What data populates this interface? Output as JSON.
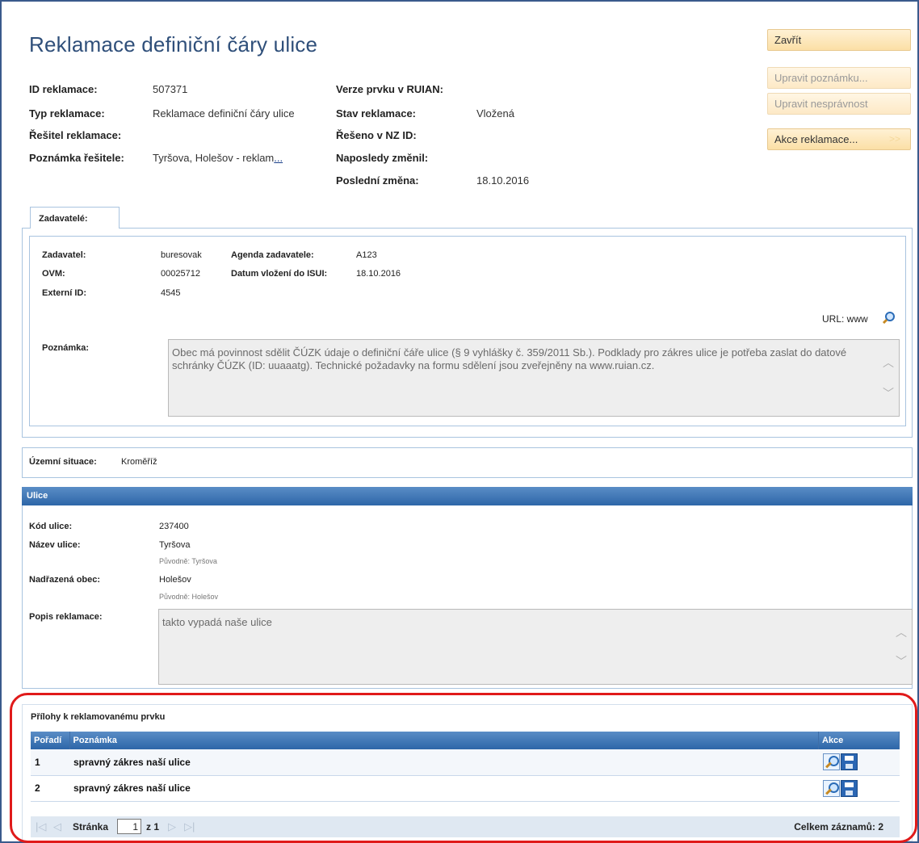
{
  "title": "Reklamace definiční čáry ulice",
  "header": {
    "id_label": "ID reklamace:",
    "id_value": "507371",
    "typ_label": "Typ reklamace:",
    "typ_value": "Reklamace definiční čáry ulice",
    "resitel_label": "Řešitel reklamace:",
    "resitel_value": "",
    "poznamka_label": "Poznámka řešitele:",
    "poznamka_value": "Tyršova, Holešov - reklam",
    "poznamka_more": "...",
    "verze_label": "Verze prvku v RUIAN:",
    "verze_value": "",
    "stav_label": "Stav reklamace:",
    "stav_value": "Vložená",
    "reseno_label": "Řešeno v NZ ID:",
    "reseno_value": "",
    "naposledy_label": "Naposledy změnil:",
    "naposledy_value": "",
    "posledni_label": "Poslední změna:",
    "posledni_value": "18.10.2016"
  },
  "buttons": {
    "zavrit": "Zavřít",
    "upravit_poznamku": "Upravit poznámku...",
    "upravit_nespravnost": "Upravit nesprávnost",
    "akce_reklamace": "Akce reklamace...",
    "akce_arrow": ">>"
  },
  "zadavatele": {
    "tab_label": "Zadavatelé:",
    "zadavatel_label": "Zadavatel:",
    "zadavatel_value": "buresovak",
    "agenda_label": "Agenda zadavatele:",
    "agenda_value": "A123",
    "ovm_label": "OVM:",
    "ovm_value": "00025712",
    "datum_label": "Datum vložení do ISUI:",
    "datum_value": "18.10.2016",
    "externi_label": "Externí ID:",
    "externi_value": "4545",
    "url_label": "URL: www",
    "poznamka_label": "Poznámka:",
    "poznamka_text": "Obec má povinnost sdělit ČÚZK údaje o definiční čáře ulice (§ 9 vyhlášky č. 359/2011 Sb.). Podklady pro zákres ulice je potřeba zaslat do datové schránky ČÚZK (ID: uuaaatg). Technické požadavky na formu sdělení jsou zveřejněny na www.ruian.cz."
  },
  "uzemni": {
    "label": "Územní situace:",
    "value": "Kroměříž"
  },
  "ulice": {
    "title": "Ulice",
    "kod_label": "Kód ulice:",
    "kod_value": "237400",
    "nazev_label": "Název ulice:",
    "nazev_value": "Tyršova",
    "nazev_orig": "Původně: Tyršova",
    "obec_label": "Nadřazená obec:",
    "obec_value": "Holešov",
    "obec_orig": "Původně: Holešov",
    "popis_label": "Popis reklamace:",
    "popis_value": "takto vypadá naše ulice"
  },
  "prilohy": {
    "title": "Přílohy k reklamovanému prvku",
    "col_poradi": "Pořadí",
    "col_poznamka": "Poznámka",
    "col_akce": "Akce",
    "rows": [
      {
        "poradi": "1",
        "poznamka": "spravný zákres naší ulice"
      },
      {
        "poradi": "2",
        "poznamka": "spravný zákres naší ulice"
      }
    ],
    "pager": {
      "first": "|◁",
      "prev": "◁",
      "next": "▷",
      "last": "▷|",
      "stranka_label": "Stránka",
      "page_value": "1",
      "of_label": "z 1",
      "celkem_label": "Celkem záznamů:",
      "celkem_value": "2"
    }
  },
  "colors": {
    "accent_blue": "#2d66a8",
    "title_blue": "#2f4f7a",
    "highlight_red": "#e01a1a",
    "button_orange": "#fbdfa6"
  }
}
